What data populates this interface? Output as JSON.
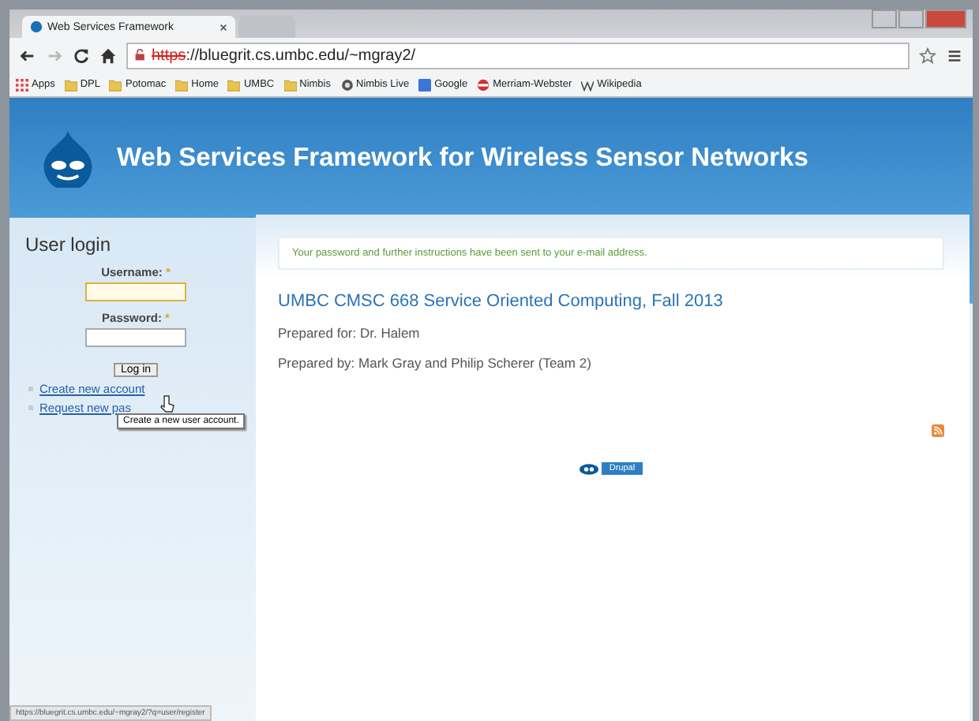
{
  "browser": {
    "tabs": [
      {
        "title": "Web Services Framework",
        "selected": true
      },
      {
        "selected": false
      }
    ],
    "address": {
      "scheme": "https",
      "rest": "://bluegrit.cs.umbc.edu/~mgray2/"
    },
    "bookmarks": [
      {
        "kind": "apps",
        "label": "Apps"
      },
      {
        "kind": "folder",
        "label": "DPL"
      },
      {
        "kind": "folder",
        "label": "Potomac"
      },
      {
        "kind": "folder",
        "label": "Home"
      },
      {
        "kind": "folder",
        "label": "UMBC"
      },
      {
        "kind": "folder",
        "label": "Nimbis"
      },
      {
        "kind": "site",
        "label": "Nimbis Live"
      },
      {
        "kind": "google",
        "label": "Google"
      },
      {
        "kind": "mw",
        "label": "Merriam-Webster"
      },
      {
        "kind": "wiki",
        "label": "Wikipedia"
      }
    ]
  },
  "site": {
    "title": "Web Services Framework for Wireless Sensor Networks"
  },
  "login": {
    "heading": "User login",
    "fields": [
      {
        "label": "Username:",
        "required": "*",
        "focused": true
      },
      {
        "label": "Password:",
        "required": "*",
        "focused": false
      }
    ],
    "button": "Log in",
    "links": [
      "Create new account",
      "Request new pas"
    ],
    "tooltip": "Create a new user account."
  },
  "message": "Your password and further instructions have been sent to your e-mail address.",
  "content": {
    "title": "UMBC CMSC 668 Service Oriented Computing, Fall 2013",
    "lines": [
      "Prepared for: Dr. Halem",
      "Prepared by: Mark Gray and Philip Scherer (Team 2)"
    ]
  },
  "footer": {
    "badge": "Drupal"
  },
  "status_bar": "https://bluegrit.cs.umbc.edu/~mgray2/?q=user/register"
}
